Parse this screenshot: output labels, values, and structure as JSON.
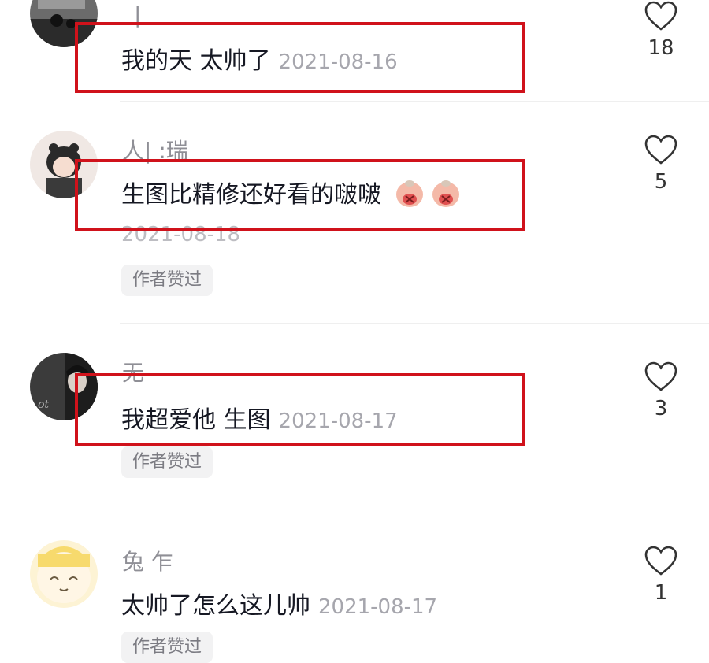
{
  "comments": [
    {
      "username": "|",
      "text": "我的天 太帅了",
      "date": "2021-08-16",
      "likes": "18",
      "author_liked": false
    },
    {
      "username": "人|          :瑞",
      "text": "生图比精修还好看的啵啵",
      "emoji": [
        "shy-face-emoji",
        "shy-face-emoji"
      ],
      "date": "2021-08-18",
      "likes": "5",
      "author_badge": "作者赞过"
    },
    {
      "username": "无",
      "text": "我超爱他 生图",
      "date": "2021-08-17",
      "likes": "3",
      "author_badge": "作者赞过"
    },
    {
      "username": "兔          乍",
      "text": "太帅了怎么这儿帅",
      "date": "2021-08-17",
      "likes": "1",
      "author_badge": "作者赞过"
    }
  ],
  "colors": {
    "highlight": "#d0121b",
    "text": "#161823",
    "muted": "#a6a6ad"
  }
}
